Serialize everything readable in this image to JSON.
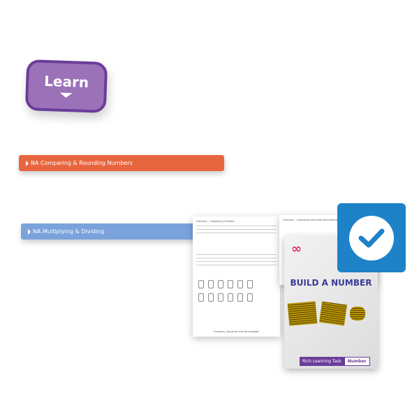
{
  "learn_button": {
    "label": "Learn",
    "icon": "caret-down-icon"
  },
  "topics": [
    {
      "label": "NA Comparing & Rounding Numbers",
      "color": "#e8663f"
    },
    {
      "label": "NA Multiplying & Dividing",
      "color": "#7aa3dc"
    }
  ],
  "worksheets": [
    {
      "title": "Fractions – simplifying fractions",
      "footer": "Fractions, Decimals and Percentages"
    },
    {
      "title": "Fractions – comparing and ordering fractions"
    }
  ],
  "cover": {
    "logo_top": "One",
    "logo_bottom": "Two",
    "title": "BUILD A NUMBER",
    "tag": "Rich Learning Task",
    "category": "Number"
  },
  "check_badge": {
    "icon": "checkmark-icon",
    "color": "#1e82c8"
  }
}
